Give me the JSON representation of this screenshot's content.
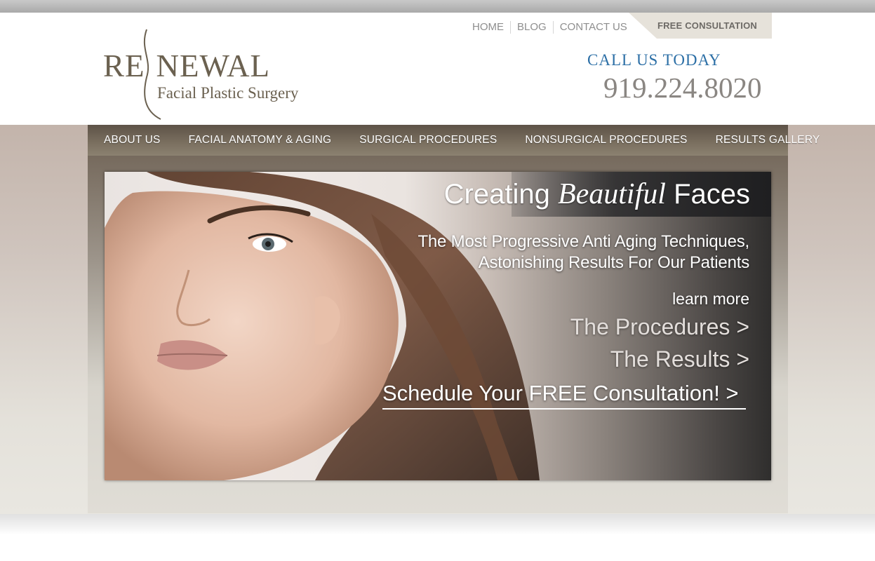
{
  "header": {
    "logo": {
      "main_left": "RE",
      "main_right": "NEWAL",
      "sub": "Facial Plastic Surgery"
    },
    "util_nav": [
      {
        "label": "HOME"
      },
      {
        "label": "BLOG"
      },
      {
        "label": "CONTACT US"
      }
    ],
    "consultation_tab": "FREE CONSULTATION",
    "call_label": "CALL US TODAY",
    "phone": "919.224.8020"
  },
  "main_nav": [
    {
      "label": "ABOUT US"
    },
    {
      "label": "FACIAL ANATOMY & AGING"
    },
    {
      "label": "SURGICAL PROCEDURES"
    },
    {
      "label": "NONSURGICAL PROCEDURES"
    },
    {
      "label": "RESULTS GALLERY"
    }
  ],
  "hero": {
    "title_start": "Creating ",
    "title_script": "Beautiful",
    "title_end": " Faces",
    "subtitle_line1": "The Most Progressive Anti Aging Techniques,",
    "subtitle_line2": "Astonishing Results For Our Patients",
    "learn_more": "learn more",
    "link_procedures": "The Procedures >",
    "link_results": "The Results >",
    "link_schedule": "Schedule Your FREE Consultation! >"
  },
  "colors": {
    "brand_text": "#6b6150",
    "call_blue": "#2c6fa6",
    "nav_bar": "#7b7060"
  }
}
